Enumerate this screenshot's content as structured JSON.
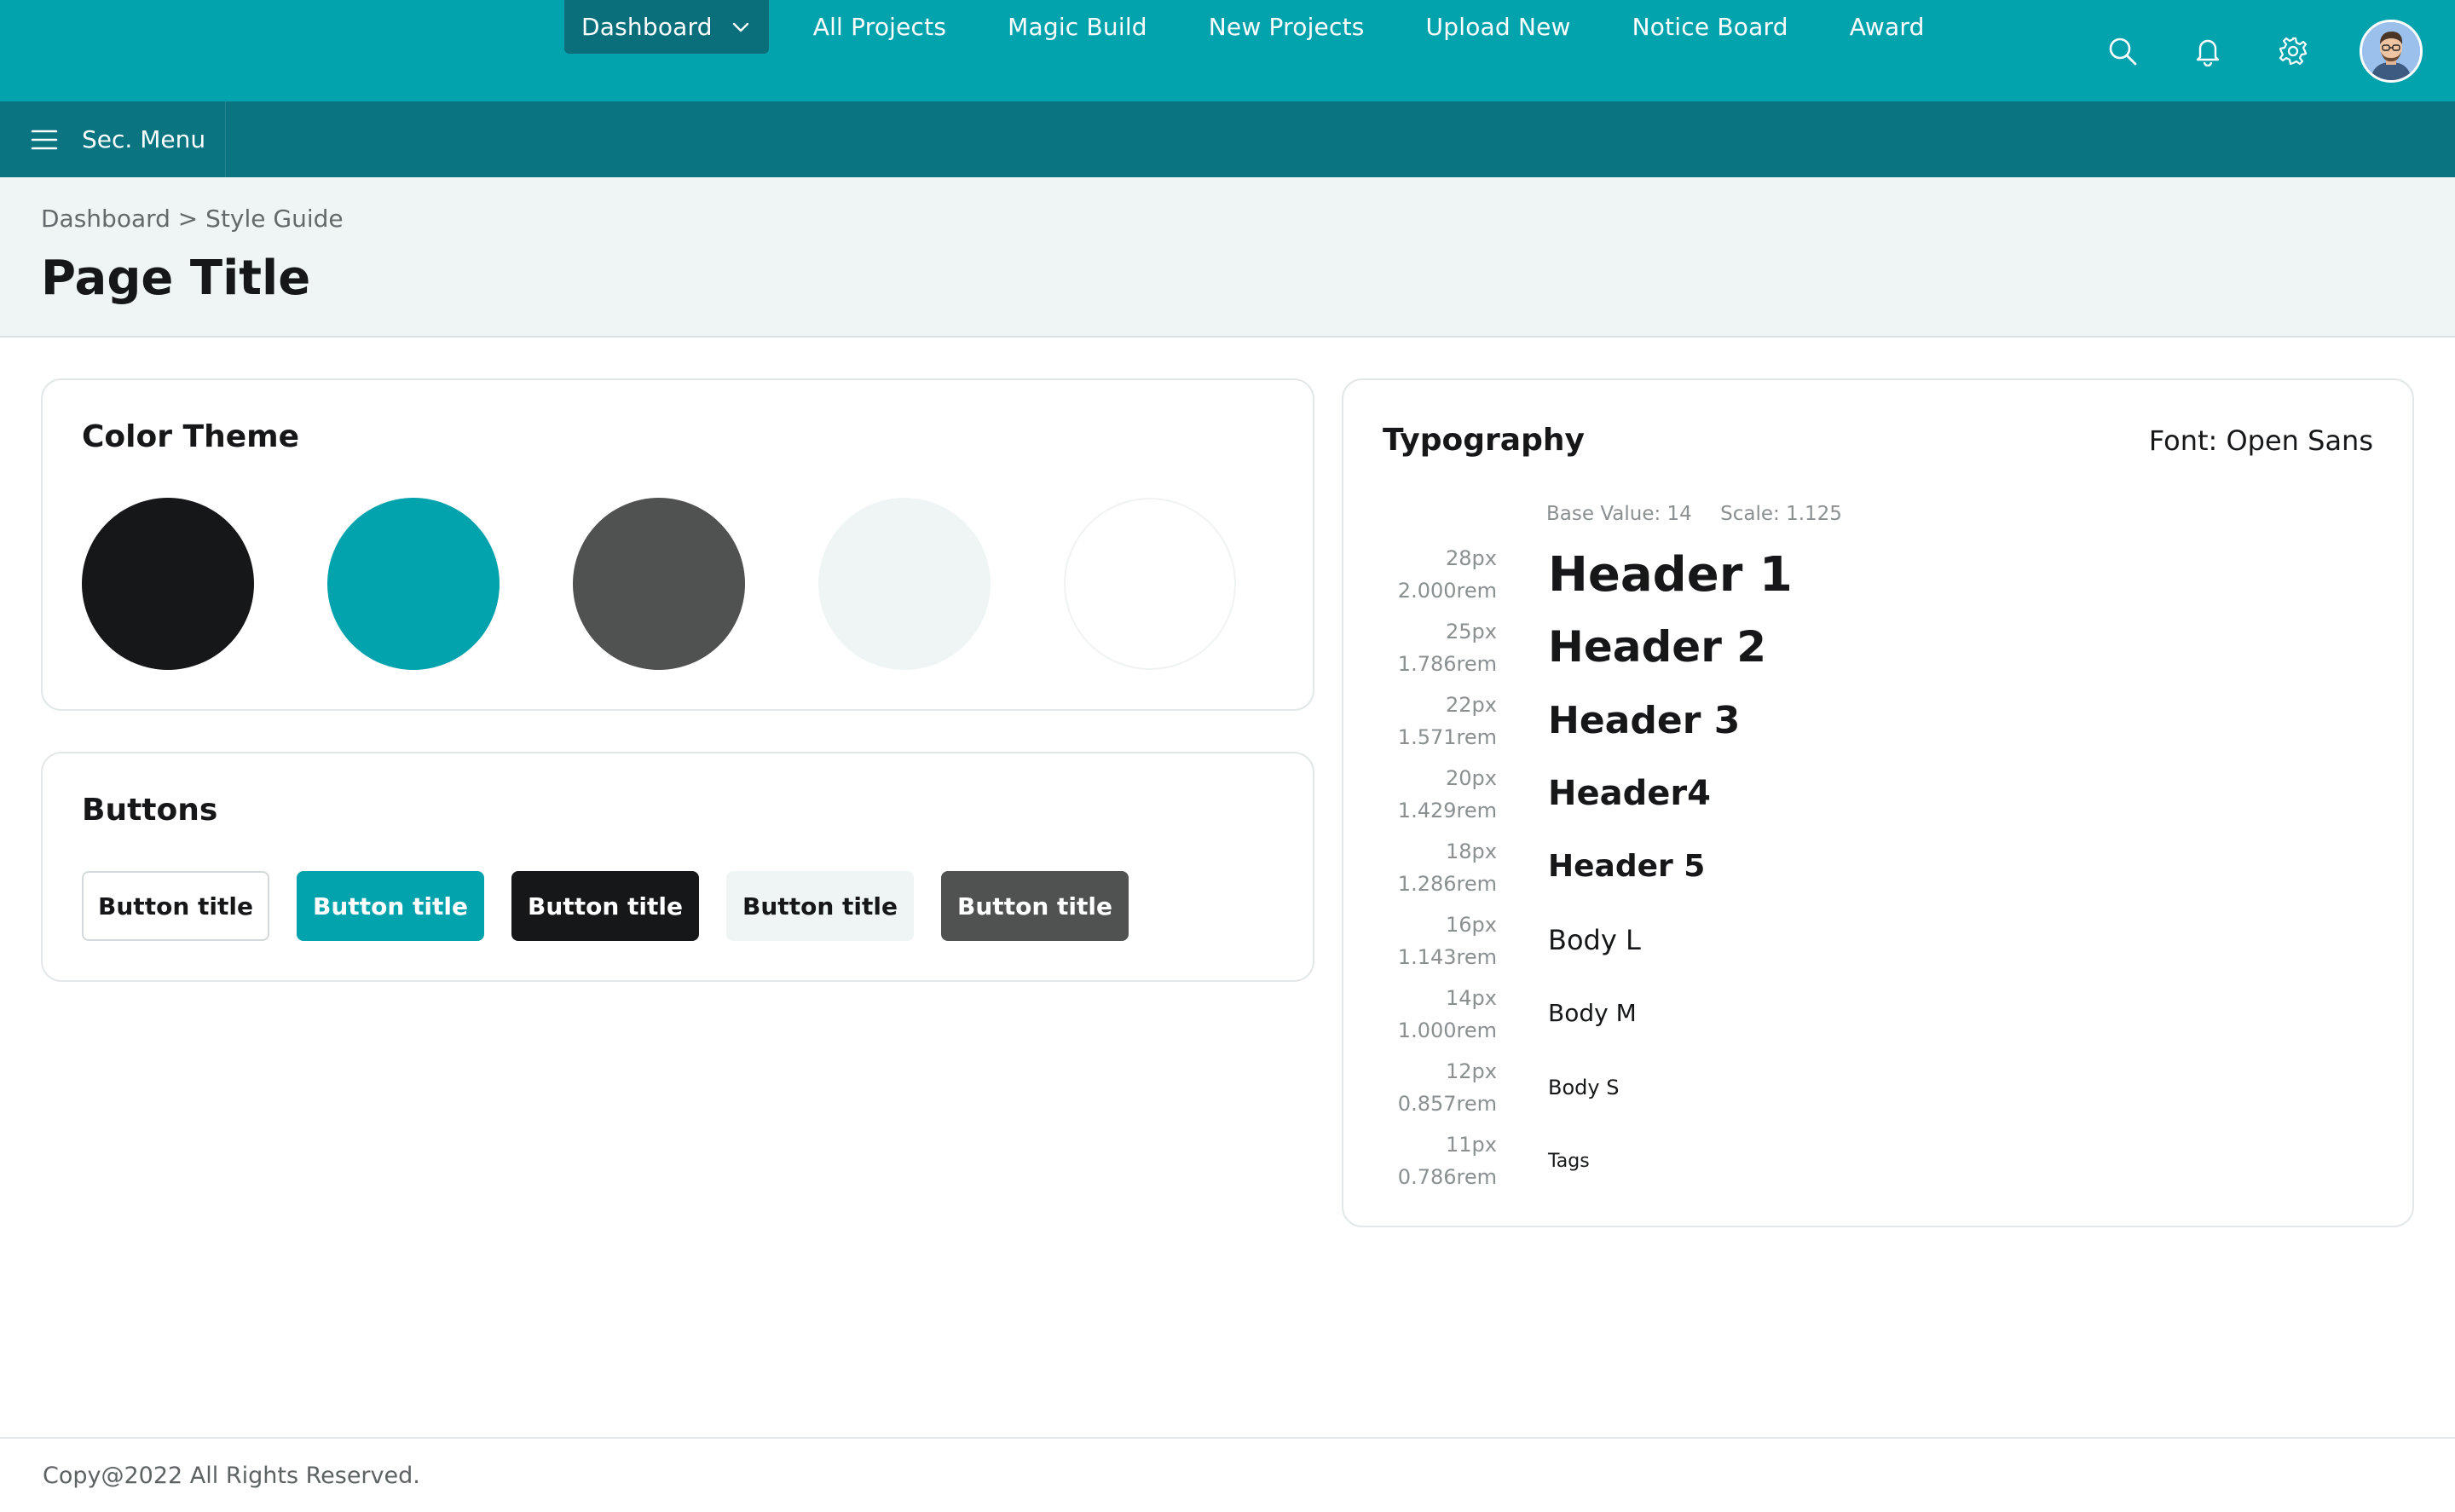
{
  "nav": {
    "items": [
      {
        "label": "Dashboard",
        "active": true
      },
      {
        "label": "All Projects"
      },
      {
        "label": "Magic Build"
      },
      {
        "label": "New Projects"
      },
      {
        "label": "Upload New"
      },
      {
        "label": "Notice Board"
      },
      {
        "label": "Award"
      }
    ],
    "icons": [
      "search-icon",
      "bell-icon",
      "gear-icon",
      "avatar"
    ]
  },
  "secondary": {
    "menu_label": "Sec. Menu",
    "icon": "hamburger-icon"
  },
  "header": {
    "breadcrumb": "Dashboard > Style Guide",
    "title": "Page Title"
  },
  "color_theme": {
    "title": "Color Theme",
    "colors": [
      "#161718",
      "#03a3ad",
      "#4f5250",
      "#eff5f5",
      "#ffffff"
    ]
  },
  "buttons": {
    "title": "Buttons",
    "items": [
      {
        "label": "Button title",
        "bg": "#ffffff",
        "fg": "#161718",
        "border": "#d4dadb"
      },
      {
        "label": "Button title",
        "bg": "#03a3ad",
        "fg": "#ffffff",
        "border": "#03a3ad"
      },
      {
        "label": "Button title",
        "bg": "#161718",
        "fg": "#ffffff",
        "border": "#161718"
      },
      {
        "label": "Button title",
        "bg": "#eff5f5",
        "fg": "#161718",
        "border": "#eff5f5"
      },
      {
        "label": "Button title",
        "bg": "#4f5250",
        "fg": "#ffffff",
        "border": "#4f5250"
      }
    ]
  },
  "typography": {
    "title": "Typography",
    "font_label": "Font: Open Sans",
    "base_value": "Base Value: 14",
    "scale": "Scale: 1.125",
    "rows": [
      {
        "px": "28px",
        "rem": "2.000rem",
        "sample": "Header 1",
        "bold": true
      },
      {
        "px": "25px",
        "rem": "1.786rem",
        "sample": "Header 2",
        "bold": true
      },
      {
        "px": "22px",
        "rem": "1.571rem",
        "sample": "Header 3",
        "bold": true
      },
      {
        "px": "20px",
        "rem": "1.429rem",
        "sample": "Header4",
        "bold": true
      },
      {
        "px": "18px",
        "rem": "1.286rem",
        "sample": "Header 5",
        "bold": true
      },
      {
        "px": "16px",
        "rem": "1.143rem",
        "sample": "Body L",
        "bold": false
      },
      {
        "px": "14px",
        "rem": "1.000rem",
        "sample": "Body M",
        "bold": false
      },
      {
        "px": "12px",
        "rem": "0.857rem",
        "sample": "Body S",
        "bold": false
      },
      {
        "px": "11px",
        "rem": "0.786rem",
        "sample": "Tags",
        "bold": false
      }
    ]
  },
  "footer": {
    "text": "Copy@2022 All Rights Reserved."
  }
}
